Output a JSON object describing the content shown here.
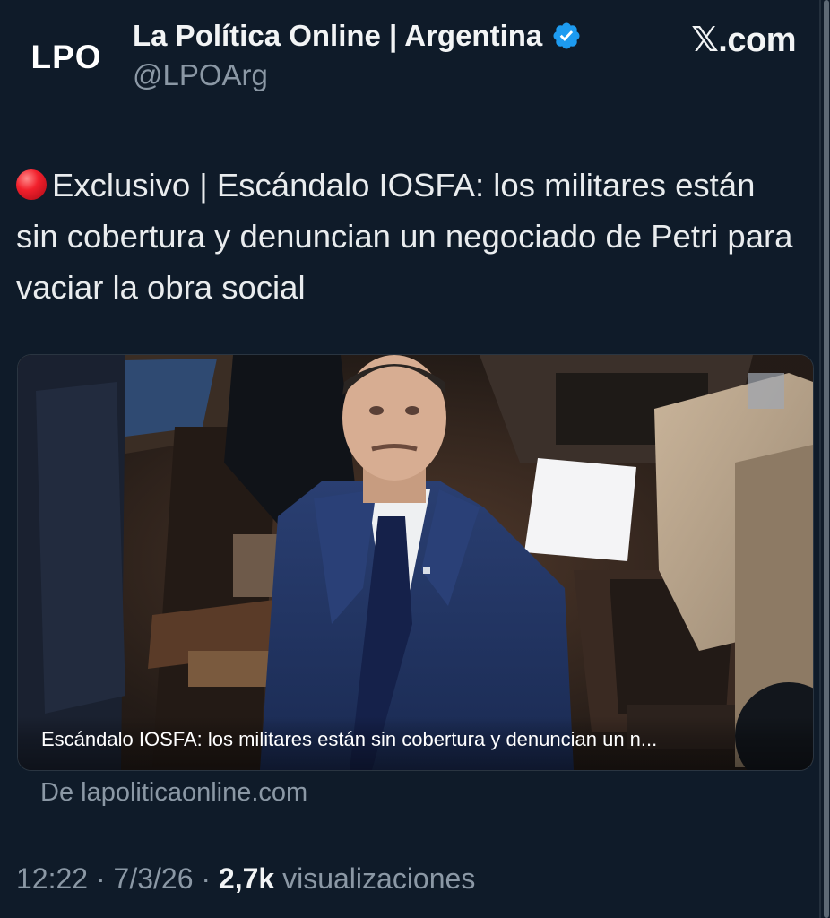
{
  "account": {
    "avatar_text": "LPO",
    "display_name": "La Política Online | Argentina",
    "handle": "@LPOArg",
    "source": "𝕏.com"
  },
  "tweet": {
    "emoji": "red-circle-icon",
    "text": "Exclusivo | Escándalo IOSFA: los militares están sin cobertura y denuncian un negociado de Petri para vaciar la obra social"
  },
  "card": {
    "caption": "Escándalo IOSFA: los militares están sin cobertura y denuncian un n...",
    "domain": "De lapoliticaonline.com"
  },
  "meta": {
    "time": "12:22",
    "separator": "·",
    "date": "7/3/26",
    "views_count": "2,7k",
    "views_label": "visualizaciones"
  },
  "colors": {
    "background": "#0f1b29",
    "verified": "#1d9bf0",
    "muted_text": "#8b98a5"
  }
}
